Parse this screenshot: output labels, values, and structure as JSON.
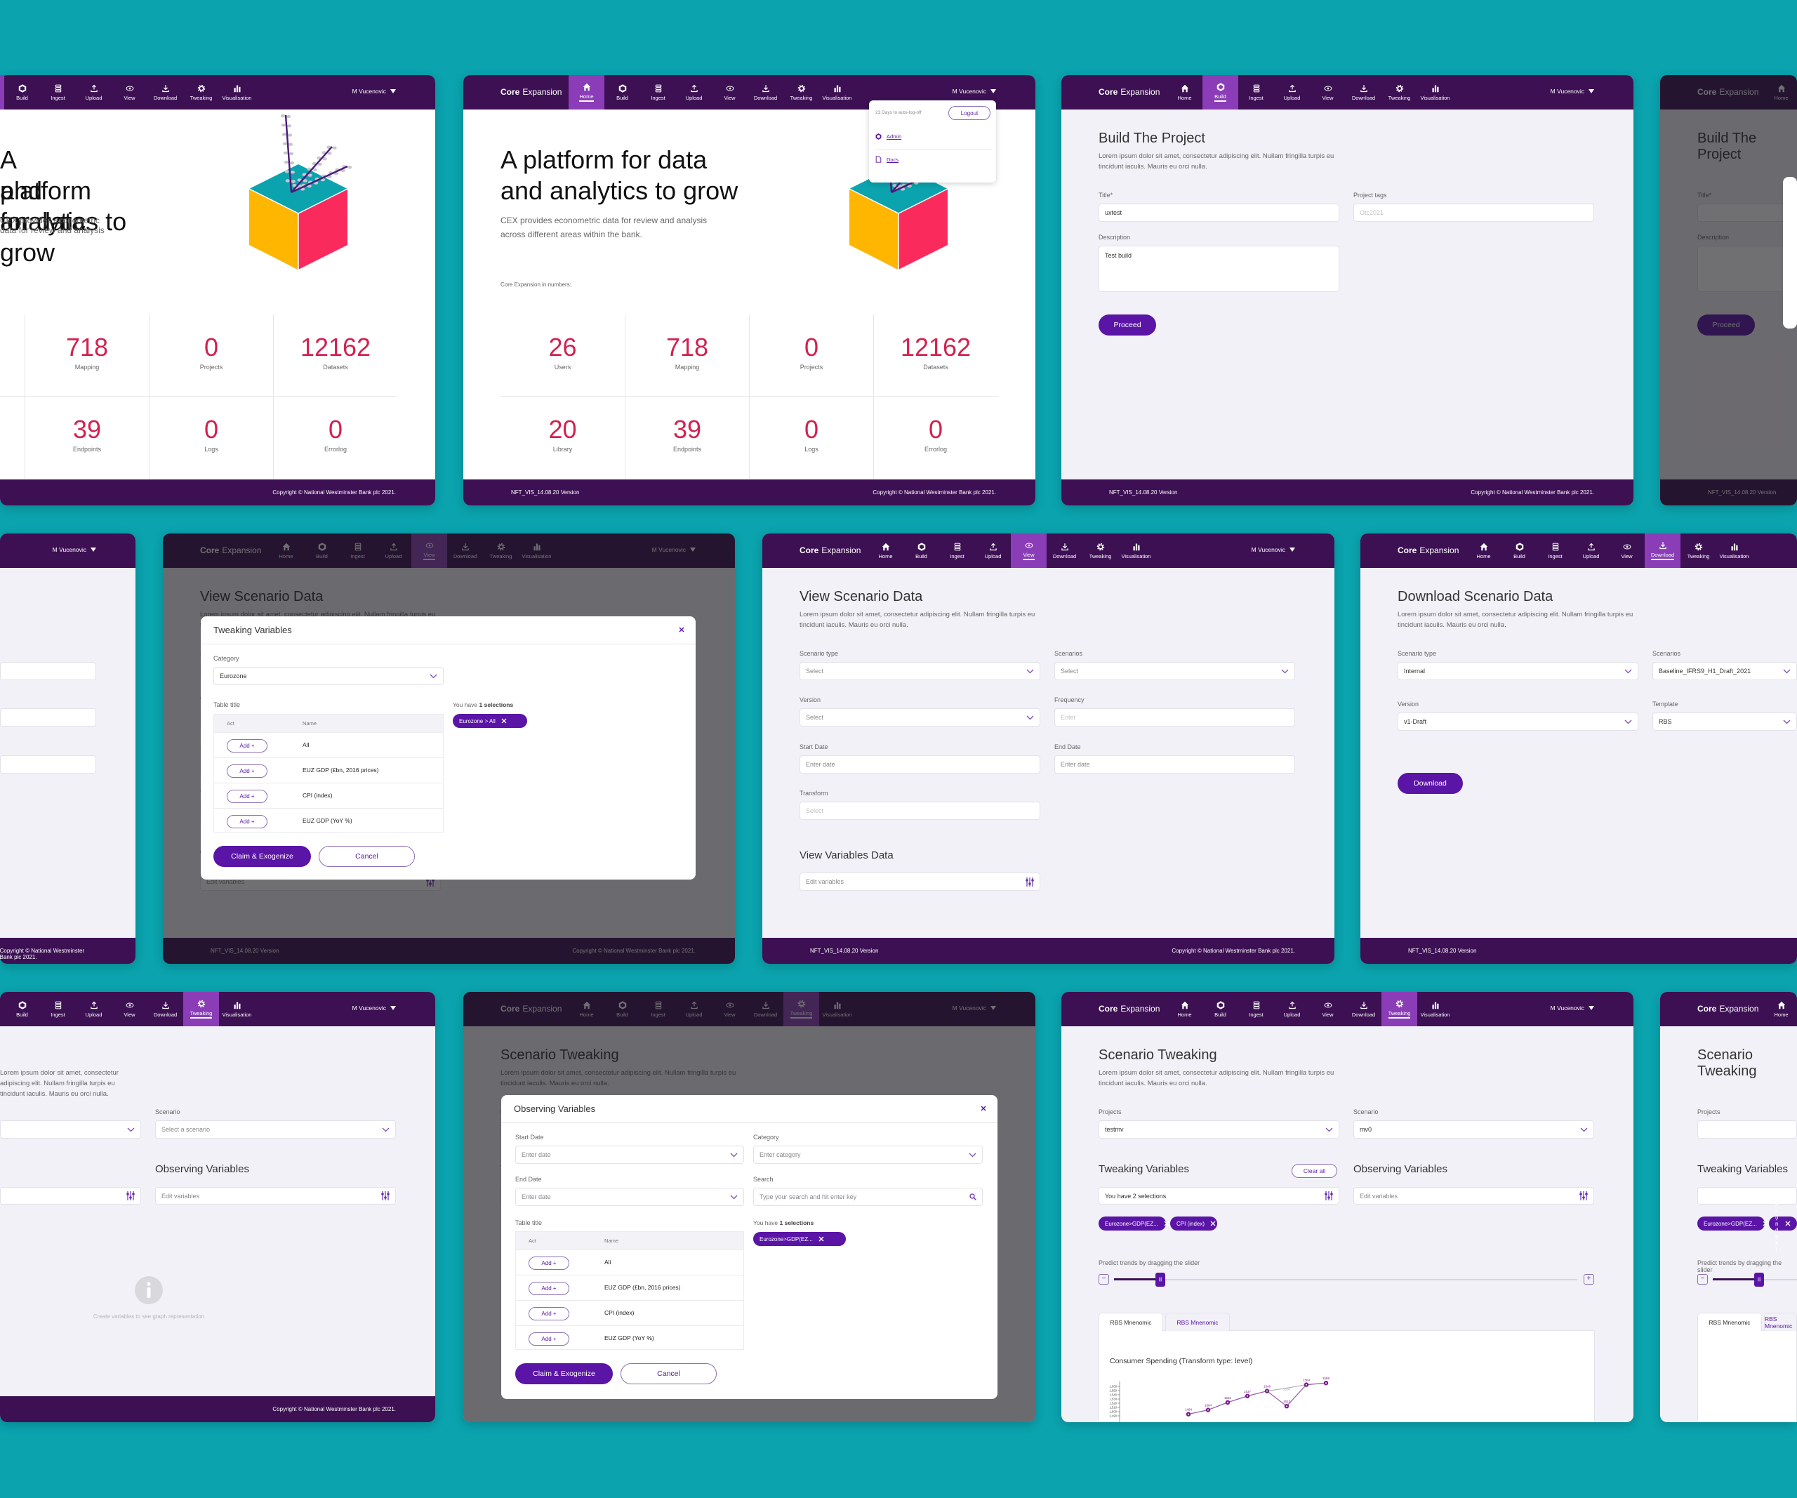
{
  "colors": {
    "background": "#0aa3ae",
    "header": "#3c1053",
    "nav_active": "#8a3db6",
    "primary": "#5a14a6",
    "stat_number": "#d3214f",
    "cube_top": "#0aa3ae",
    "cube_left": "#ffb600",
    "cube_right": "#fb2a5c"
  },
  "app": {
    "brand_bold": "Core",
    "brand_light": "Expansion",
    "user": "M Vucenovic",
    "version": "NFT_VIS_14.08.20 Version",
    "copyright": "Copyright © National Westminster Bank plc 2021."
  },
  "nav": [
    {
      "label": "Home",
      "icon": "home-icon"
    },
    {
      "label": "Build",
      "icon": "build-icon"
    },
    {
      "label": "Ingest",
      "icon": "ingest-icon"
    },
    {
      "label": "Upload",
      "icon": "upload-icon"
    },
    {
      "label": "View",
      "icon": "view-icon"
    },
    {
      "label": "Download",
      "icon": "download-icon"
    },
    {
      "label": "Tweaking",
      "icon": "tweaking-icon"
    },
    {
      "label": "Visualisation",
      "icon": "visualisation-icon"
    }
  ],
  "user_menu": {
    "auto_logoff": "23 Days to auto-log-off",
    "logout": "Logout",
    "items": [
      {
        "label": "Admin",
        "icon": "admin-icon"
      },
      {
        "label": "Docs",
        "icon": "document-icon"
      }
    ]
  },
  "screens": {
    "home": {
      "headline": [
        "A platform for data",
        "and analytics to grow"
      ],
      "subtitle": [
        "CEX provides econometric data for review and analysis",
        "across different areas within the bank."
      ],
      "numbers_label": "Core Expansion in numbers:",
      "stats": [
        [
          {
            "value": "26",
            "label": "Users"
          },
          {
            "value": "718",
            "label": "Mapping"
          },
          {
            "value": "0",
            "label": "Projects"
          },
          {
            "value": "12162",
            "label": "Datasets"
          }
        ],
        [
          {
            "value": "20",
            "label": "Library"
          },
          {
            "value": "39",
            "label": "Endpoints"
          },
          {
            "value": "0",
            "label": "Logs"
          },
          {
            "value": "0",
            "label": "Errorlog"
          }
        ]
      ]
    },
    "build": {
      "title": "Build The Project",
      "description": "Lorem ipsum dolor sit amet, consectetur adipiscing elit. Nullam fringilla turpis eu tincidunt iaculis. Mauris eu orci nulla.",
      "title_label": "Title*",
      "title_value": "uxtest",
      "tags_label": "Project tags",
      "tags_placeholder": "Otc2021",
      "description_label": "Description",
      "description_value": "Test build",
      "proceed": "Proceed"
    },
    "view": {
      "title": "View Scenario Data",
      "description": "Lorem ipsum dolor sit amet, consectetur adipiscing elit. Nullam fringilla turpis eu tincidunt iaculis. Mauris eu orci nulla.",
      "scenario_type_label": "Scenario type",
      "scenario_type_placeholder": "Select",
      "scenarios_label": "Scenarios",
      "scenarios_placeholder": "Select",
      "version_label": "Version",
      "version_placeholder": "Select",
      "frequency_label": "Frequency",
      "frequency_placeholder": "Enter",
      "start_label": "Start Date",
      "start_placeholder": "Enter date",
      "end_label": "End Date",
      "end_placeholder": "Enter date",
      "transform_label": "Transform",
      "transform_placeholder": "Select",
      "variables_heading": "View Variables Data",
      "variables_placeholder": "Edit variables"
    },
    "download": {
      "title": "Download Scenario Data",
      "description": "Lorem ipsum dolor sit amet, consectetur adipiscing elit. Nullam fringilla turpis eu tincidunt iaculis. Mauris eu orci nulla.",
      "scenario_type_label": "Scenario type",
      "scenario_type_value": "Internal",
      "scenarios_label": "Scenarios",
      "scenarios_value": "Baseline_IFRS9_H1_Draft_2021",
      "version_label": "Version",
      "version_value": "v1-Draft",
      "template_label": "Template",
      "template_value": "RBS",
      "download": "Download"
    },
    "tweaking": {
      "title": "Scenario Tweaking",
      "description": "Lorem ipsum dolor sit amet, consectetur adipiscing elit. Nullam fringilla turpis eu tincidunt iaculis. Mauris eu orci nulla.",
      "projects_label": "Projects",
      "scenario_label": "Scenario",
      "tweaking_heading": "Tweaking Variables",
      "observing_heading": "Observing Variables",
      "edit_variables_placeholder": "Edit variables",
      "empty": {
        "scenario_placeholder": "Select a scenario",
        "info_text": "Create variables to see graph representation"
      },
      "filled": {
        "projects_value": "testmv",
        "scenario_value": "mv0",
        "clear_all": "Clear all",
        "selections_text": "You have 2 selections",
        "chips": [
          "Eurozone>GDP(EZ...",
          "CPI (index)"
        ],
        "slider_label": "Predict trends by dragging the slider",
        "slider_value": 0.1,
        "tabs": [
          "RBS Mnenomic",
          "RBS Mnenomic"
        ],
        "active_tab": 0
      }
    }
  },
  "modals": {
    "tweaking_variables": {
      "title": "Tweaking Variables",
      "category_label": "Category",
      "category_value": "Eurozone",
      "table_title": "Table title",
      "columns": [
        "Act",
        "Name"
      ],
      "rows": [
        {
          "action": "Add +",
          "name": "All"
        },
        {
          "action": "Add +",
          "name": "EUZ GDP (£bn, 2016 prices)"
        },
        {
          "action": "Add +",
          "name": "CPI (index)"
        },
        {
          "action": "Add +",
          "name": "EUZ GDP (YoY %)"
        }
      ],
      "selections_prefix": "You have",
      "selections_count": "1 selections",
      "chip": "Eurozone > All",
      "claim": "Claim & Exogenize",
      "cancel": "Cancel"
    },
    "observing_variables": {
      "title": "Observing Variables",
      "start_label": "Start Date",
      "start_placeholder": "Enter date",
      "category_label": "Category",
      "category_placeholder": "Enter category",
      "end_label": "End Date",
      "end_placeholder": "Enter date",
      "search_label": "Search",
      "search_placeholder": "Type your search and hit enter key",
      "table_title": "Table title",
      "columns": [
        "Act",
        "Name"
      ],
      "rows": [
        {
          "action": "Add +",
          "name": "Ali"
        },
        {
          "action": "Add +",
          "name": "EUZ GDP (£bn, 2016 prices)"
        },
        {
          "action": "Add +",
          "name": "CPI (index)"
        },
        {
          "action": "Add +",
          "name": "EUZ GDP (YoY %)"
        }
      ],
      "selections_prefix": "You have",
      "selections_count": "1 selections",
      "chip": "Eurozone>GDP(EZ...",
      "claim": "Claim & Exogenize",
      "cancel": "Cancel"
    }
  },
  "panels": [
    {
      "screen": "home",
      "active_nav": "Home",
      "show_footer": true
    },
    {
      "screen": "home",
      "active_nav": "Home",
      "show_footer": true,
      "user_menu_open": true
    },
    {
      "screen": "build",
      "active_nav": "Build",
      "show_footer": true
    },
    {
      "screen": "build",
      "active_nav": "",
      "show_footer": true,
      "dimmed": true,
      "modal": "blank"
    },
    {
      "screen": "view",
      "active_nav": "View",
      "show_footer": true
    },
    {
      "screen": "view",
      "active_nav": "View",
      "show_footer": true,
      "dimmed": true,
      "modal": "tweaking_variables"
    },
    {
      "screen": "view",
      "active_nav": "View",
      "show_footer": true
    },
    {
      "screen": "download",
      "active_nav": "Download",
      "show_footer": true
    },
    {
      "screen": "tweaking",
      "state": "empty",
      "active_nav": "Tweaking",
      "show_footer": true
    },
    {
      "screen": "tweaking",
      "state": "empty",
      "active_nav": "Tweaking",
      "show_footer": false,
      "dimmed": true,
      "modal": "observing_variables"
    },
    {
      "screen": "tweaking",
      "state": "filled",
      "active_nav": "Tweaking",
      "show_footer": false
    },
    {
      "screen": "tweaking",
      "state": "filled",
      "active_nav": "Tweaking",
      "show_footer": false
    }
  ],
  "chart_data": {
    "type": "line",
    "title": "Consumer Spending (Transform type: level)",
    "y_tick_labels": [
      "1,490",
      "1,500",
      "1,510",
      "1,520",
      "1,530",
      "1,540",
      "1,550",
      "1,560"
    ],
    "y_ticks": [
      1490,
      1500,
      1510,
      1520,
      1530,
      1540,
      1550,
      1560
    ],
    "ylim": [
      1485,
      1572
    ],
    "grid": false,
    "series": [
      {
        "values": [
          1494,
          1504,
          1522,
          1537,
          1549,
          1513,
          1564,
          1568
        ],
        "labels": [
          "1494",
          "1504",
          "1522",
          "1537",
          "1549",
          "1513",
          "1564",
          "1568"
        ]
      },
      {
        "values": [
          1494,
          1504,
          1522,
          1537,
          1549,
          1556,
          1564,
          1568
        ],
        "labels": [
          "",
          "",
          "",
          "",
          "",
          "1556",
          "",
          ""
        ]
      }
    ]
  }
}
